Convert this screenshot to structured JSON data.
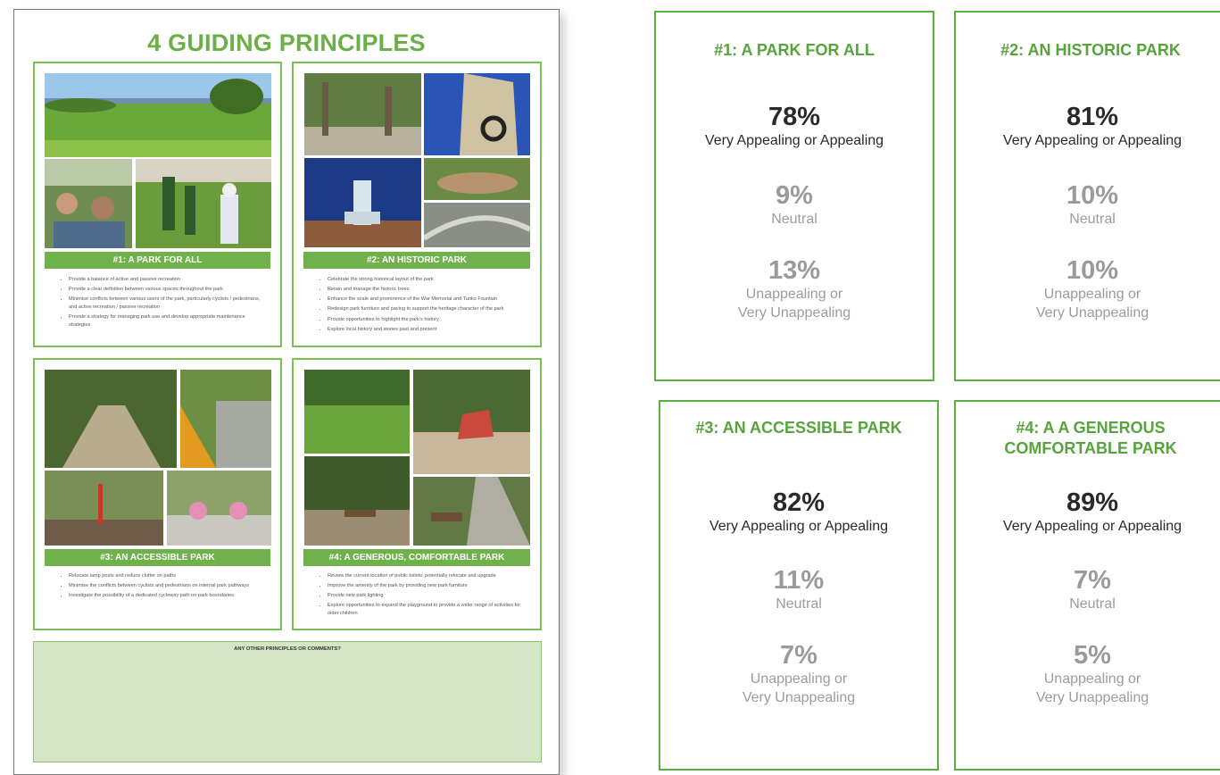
{
  "poster": {
    "title": "4 GUIDING PRINCIPLES",
    "principles": [
      {
        "banner": "#1: A PARK FOR ALL",
        "bullets": [
          "Provide a balance of active and passive recreation",
          "Provide a clear definition between various spaces throughout the park",
          "Minimise conflicts between various users of the park, particularly cyclists / pedestrians, and active recreation / passive recreation",
          "Provide a strategy for managing park use and develop appropriate maintenance strategies"
        ]
      },
      {
        "banner": "#2: AN HISTORIC PARK",
        "bullets": [
          "Celebrate the strong historical layout of the park",
          "Retain and manage the historic trees",
          "Enhance the scale and prominence of the War Memorial and Tunks Fountain",
          "Redesign park furniture and paving to support the heritage character of the park",
          "Provide opportunities to highlight the park's history",
          "Explore local history and stories past and present"
        ]
      },
      {
        "banner": "#3: AN ACCESSIBLE PARK",
        "bullets": [
          "Relocate lamp posts and reduce clutter on paths",
          "Minimise the conflicts between cyclists and pedestrians on internal park pathways",
          "Investigate the possibility of a dedicated cycleway path on park boundaries"
        ]
      },
      {
        "banner": "#4: A GENEROUS, COMFORTABLE PARK",
        "bullets": [
          "Review the current location of public toilets; potentially relocate and upgrade",
          "Improve the amenity of the park by providing new park furniture",
          "Provide new park lighting",
          "Explore opportunities to expand the playground to provide a wider range of activities for older children"
        ]
      }
    ],
    "comments_label": "ANY OTHER PRINCIPLES OR COMMENTS?"
  },
  "results": [
    {
      "title": "#1: A PARK FOR ALL",
      "appealing_pct": "78%",
      "appealing_label": "Very Appealing or Appealing",
      "neutral_pct": "9%",
      "neutral_label": "Neutral",
      "unappealing_pct": "13%",
      "unappealing_label_1": "Unappealing or",
      "unappealing_label_2": "Very Unappealing"
    },
    {
      "title": "#2: AN HISTORIC PARK",
      "appealing_pct": "81%",
      "appealing_label": "Very Appealing or Appealing",
      "neutral_pct": "10%",
      "neutral_label": "Neutral",
      "unappealing_pct": "10%",
      "unappealing_label_1": "Unappealing or",
      "unappealing_label_2": "Very Unappealing"
    },
    {
      "title": "#3: AN ACCESSIBLE PARK",
      "appealing_pct": "82%",
      "appealing_label": "Very Appealing or Appealing",
      "neutral_pct": "11%",
      "neutral_label": "Neutral",
      "unappealing_pct": "7%",
      "unappealing_label_1": "Unappealing or",
      "unappealing_label_2": "Very Unappealing"
    },
    {
      "title_1": "#4: A A GENEROUS",
      "title_2": "COMFORTABLE PARK",
      "appealing_pct": "89%",
      "appealing_label": "Very Appealing or Appealing",
      "neutral_pct": "7%",
      "neutral_label": "Neutral",
      "unappealing_pct": "5%",
      "unappealing_label_1": "Unappealing or",
      "unappealing_label_2": "Very Unappealing"
    }
  ]
}
